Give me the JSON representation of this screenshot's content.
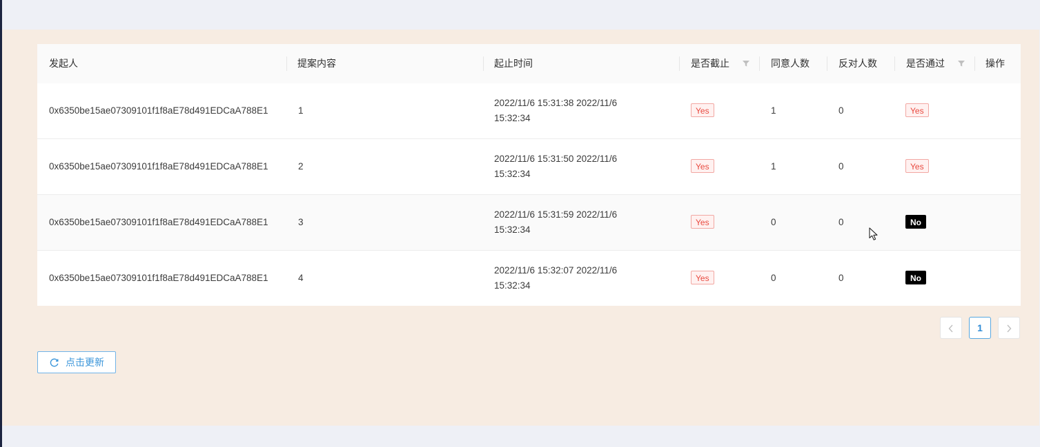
{
  "table": {
    "columns": {
      "initiator": "发起人",
      "proposal": "提案内容",
      "period": "起止时间",
      "is_closed": "是否截止",
      "agree_count": "同意人数",
      "oppose_count": "反对人数",
      "is_passed": "是否通过",
      "actions": "操作"
    },
    "rows": [
      {
        "initiator": "0x6350be15ae07309101f1f8aE78d491EDCaA788E1",
        "proposal": "1",
        "time_line1": "2022/11/6 15:31:38 2022/11/6",
        "time_line2": "15:32:34",
        "is_closed": "Yes",
        "agree": "1",
        "oppose": "0",
        "passed": "Yes",
        "passed_state": "yes"
      },
      {
        "initiator": "0x6350be15ae07309101f1f8aE78d491EDCaA788E1",
        "proposal": "2",
        "time_line1": "2022/11/6 15:31:50 2022/11/6",
        "time_line2": "15:32:34",
        "is_closed": "Yes",
        "agree": "1",
        "oppose": "0",
        "passed": "Yes",
        "passed_state": "yes"
      },
      {
        "initiator": "0x6350be15ae07309101f1f8aE78d491EDCaA788E1",
        "proposal": "3",
        "time_line1": "2022/11/6 15:31:59 2022/11/6",
        "time_line2": "15:32:34",
        "is_closed": "Yes",
        "agree": "0",
        "oppose": "0",
        "passed": "No",
        "passed_state": "no"
      },
      {
        "initiator": "0x6350be15ae07309101f1f8aE78d491EDCaA788E1",
        "proposal": "4",
        "time_line1": "2022/11/6 15:32:07 2022/11/6",
        "time_line2": "15:32:34",
        "is_closed": "Yes",
        "agree": "0",
        "oppose": "0",
        "passed": "No",
        "passed_state": "no"
      }
    ]
  },
  "pagination": {
    "current_page": "1",
    "prev_icon": "chevron-left-icon",
    "next_icon": "chevron-right-icon"
  },
  "refresh_button": {
    "label": "点击更新",
    "icon": "refresh-icon"
  },
  "colors": {
    "panel_bg": "#f7ece2",
    "page_bg": "#eef0f6",
    "yes_tag_text": "#e8493f",
    "no_tag_bg": "#000000",
    "accent": "#3a95da"
  }
}
